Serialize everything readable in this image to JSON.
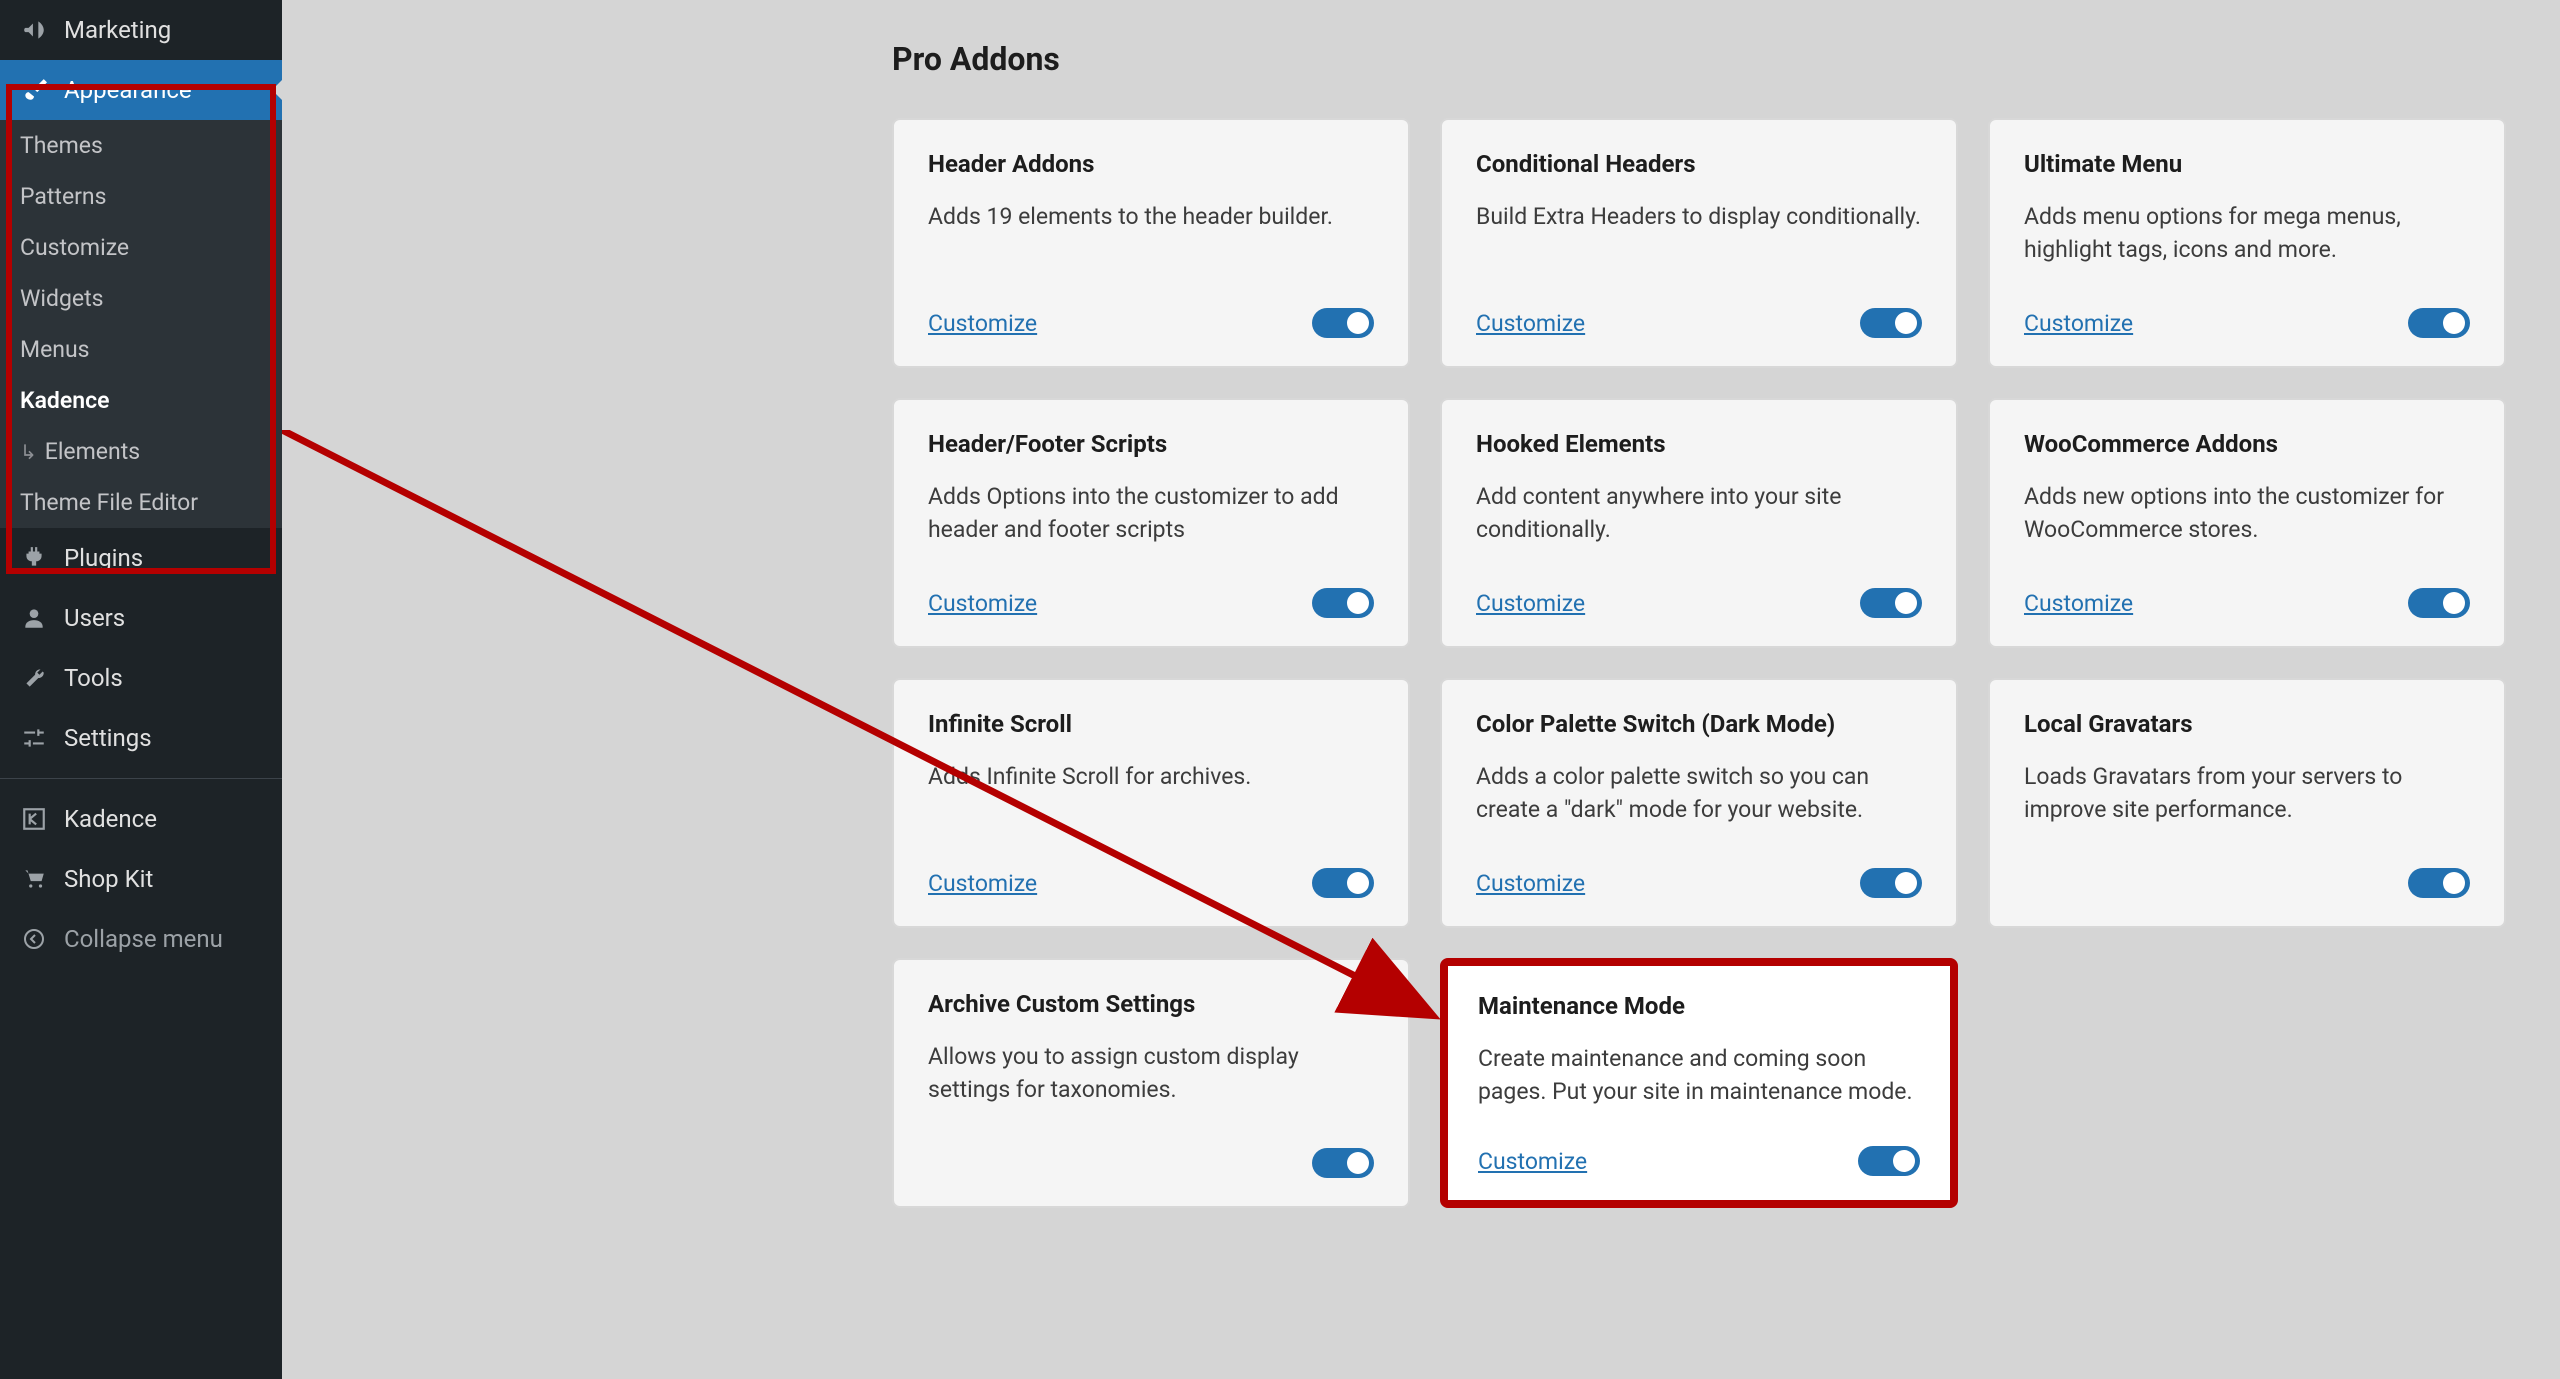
{
  "sidebar": {
    "top": [
      {
        "id": "marketing",
        "label": "Marketing",
        "icon": "megaphone"
      }
    ],
    "appearance": {
      "label": "Appearance"
    },
    "submenu": [
      {
        "id": "themes",
        "label": "Themes"
      },
      {
        "id": "patterns",
        "label": "Patterns"
      },
      {
        "id": "customize",
        "label": "Customize"
      },
      {
        "id": "widgets",
        "label": "Widgets"
      },
      {
        "id": "menus",
        "label": "Menus"
      },
      {
        "id": "kadence",
        "label": "Kadence",
        "current": true
      },
      {
        "id": "elements",
        "label": "Elements",
        "indent": true
      },
      {
        "id": "theme-file-editor",
        "label": "Theme File Editor"
      }
    ],
    "bottom": [
      {
        "id": "plugins",
        "label": "Plugins",
        "icon": "plug"
      },
      {
        "id": "users",
        "label": "Users",
        "icon": "user"
      },
      {
        "id": "tools",
        "label": "Tools",
        "icon": "wrench"
      },
      {
        "id": "settings",
        "label": "Settings",
        "icon": "sliders"
      }
    ],
    "extras": [
      {
        "id": "kadence2",
        "label": "Kadence",
        "icon": "bracket"
      },
      {
        "id": "shopkit",
        "label": "Shop Kit",
        "icon": "cart"
      }
    ],
    "collapse": {
      "label": "Collapse menu"
    }
  },
  "page": {
    "title": "Pro Addons",
    "customize_label": "Customize"
  },
  "addons": [
    {
      "title": "Header Addons",
      "desc": "Adds 19 elements to the header builder.",
      "customize": true
    },
    {
      "title": "Conditional Headers",
      "desc": "Build Extra Headers to display conditionally.",
      "customize": true
    },
    {
      "title": "Ultimate Menu",
      "desc": "Adds menu options for mega menus, highlight tags, icons and more.",
      "customize": true
    },
    {
      "title": "Header/Footer Scripts",
      "desc": "Adds Options into the customizer to add header and footer scripts",
      "customize": true
    },
    {
      "title": "Hooked Elements",
      "desc": "Add content anywhere into your site conditionally.",
      "customize": true
    },
    {
      "title": "WooCommerce Addons",
      "desc": "Adds new options into the customizer for WooCommerce stores.",
      "customize": true
    },
    {
      "title": "Infinite Scroll",
      "desc": "Adds Infinite Scroll for archives.",
      "customize": true
    },
    {
      "title": "Color Palette Switch (Dark Mode)",
      "desc": "Adds a color palette switch so you can create a \"dark\" mode for your website.",
      "customize": true
    },
    {
      "title": "Local Gravatars",
      "desc": "Loads Gravatars from your servers to improve site performance.",
      "customize": false
    },
    {
      "title": "Archive Custom Settings",
      "desc": "Allows you to assign custom display settings for taxonomies.",
      "customize": false
    },
    {
      "title": "Maintenance Mode",
      "desc": "Create maintenance and coming soon pages. Put your site in maintenance mode.",
      "customize": true,
      "highlighted": true
    }
  ]
}
